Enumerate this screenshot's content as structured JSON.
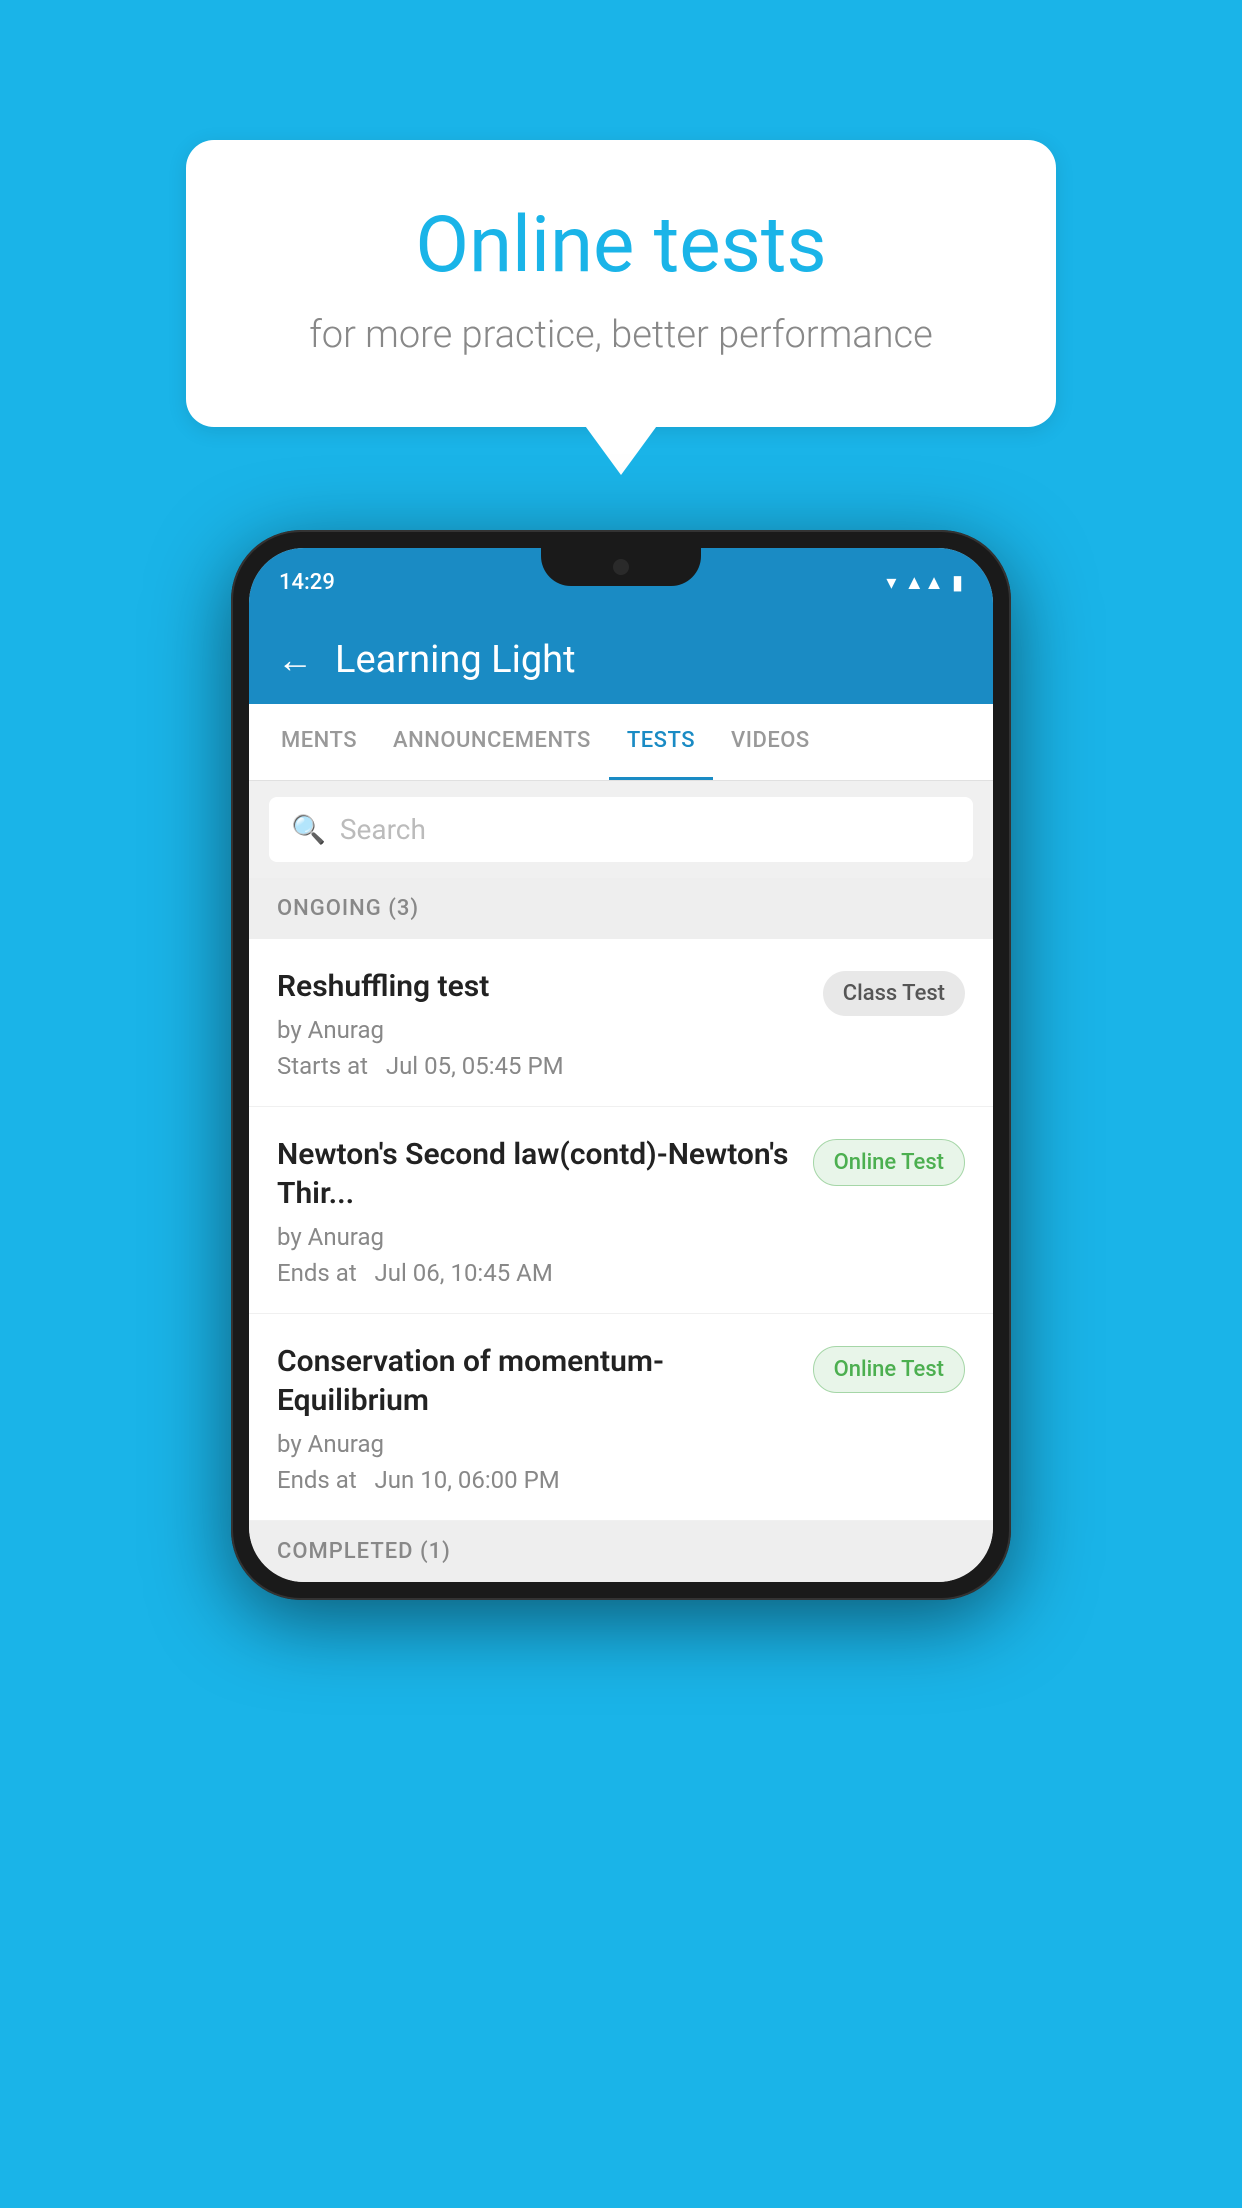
{
  "background_color": "#1ab4e8",
  "speech_bubble": {
    "title": "Online tests",
    "subtitle": "for more practice, better performance"
  },
  "phone": {
    "status_bar": {
      "time": "14:29",
      "icons": [
        "wifi",
        "signal",
        "battery"
      ]
    },
    "app_header": {
      "back_label": "←",
      "title": "Learning Light"
    },
    "tabs": [
      {
        "label": "MENTS",
        "active": false
      },
      {
        "label": "ANNOUNCEMENTS",
        "active": false
      },
      {
        "label": "TESTS",
        "active": true
      },
      {
        "label": "VIDEOS",
        "active": false
      }
    ],
    "search": {
      "placeholder": "Search"
    },
    "ongoing_section": {
      "header": "ONGOING (3)",
      "items": [
        {
          "title": "Reshuffling test",
          "by": "by Anurag",
          "date_label": "Starts at",
          "date": "Jul 05, 05:45 PM",
          "badge": "Class Test",
          "badge_type": "class"
        },
        {
          "title": "Newton's Second law(contd)-Newton's Thir...",
          "by": "by Anurag",
          "date_label": "Ends at",
          "date": "Jul 06, 10:45 AM",
          "badge": "Online Test",
          "badge_type": "online"
        },
        {
          "title": "Conservation of momentum-Equilibrium",
          "by": "by Anurag",
          "date_label": "Ends at",
          "date": "Jun 10, 06:00 PM",
          "badge": "Online Test",
          "badge_type": "online"
        }
      ]
    },
    "completed_section": {
      "header": "COMPLETED (1)"
    }
  }
}
